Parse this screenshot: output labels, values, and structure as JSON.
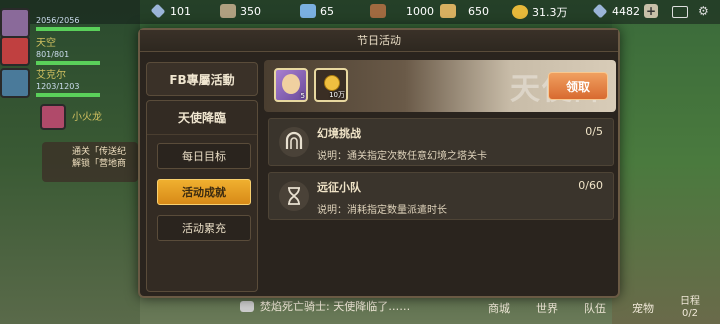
{
  "topbar": {
    "resources": [
      {
        "value": "101"
      },
      {
        "value": "350"
      },
      {
        "value": "65"
      },
      {
        "value": "1000"
      },
      {
        "value": "650"
      },
      {
        "value": "31.3万"
      }
    ],
    "gems": "4482"
  },
  "players": [
    {
      "hp": "2056/2056"
    },
    {
      "name": "天空",
      "hp": "801/801"
    },
    {
      "name": "艾克尔",
      "hp": "1203/1203"
    },
    {
      "name": "小火龙"
    }
  ],
  "quest": {
    "line1": "通关「传送纪",
    "line2": "解锁「营地商"
  },
  "chat": {
    "text": "焚焰死亡骑士: 天使降临了……"
  },
  "bottomnav": [
    "商城",
    "世界",
    "队伍",
    "宠物"
  ],
  "dialog": {
    "title": "节日活动",
    "tabs": {
      "fb": "FB專屬活動",
      "event": "天使降臨",
      "sub": [
        "每日目标",
        "活动成就",
        "活动累充"
      ]
    },
    "banner": {
      "watermark": "天使降",
      "claim": "领取"
    },
    "rewards": [
      {
        "count": "5"
      },
      {
        "count": "10万"
      }
    ],
    "tasks": [
      {
        "name": "幻境挑战",
        "progress": "0/5",
        "desc": "说明：通关指定次数任意幻境之塔关卡"
      },
      {
        "name": "远征小队",
        "progress": "0/60",
        "desc": "说明：消耗指定数量派遣时长"
      }
    ]
  },
  "rightside": {
    "label": "日程",
    "count": "0/2"
  }
}
